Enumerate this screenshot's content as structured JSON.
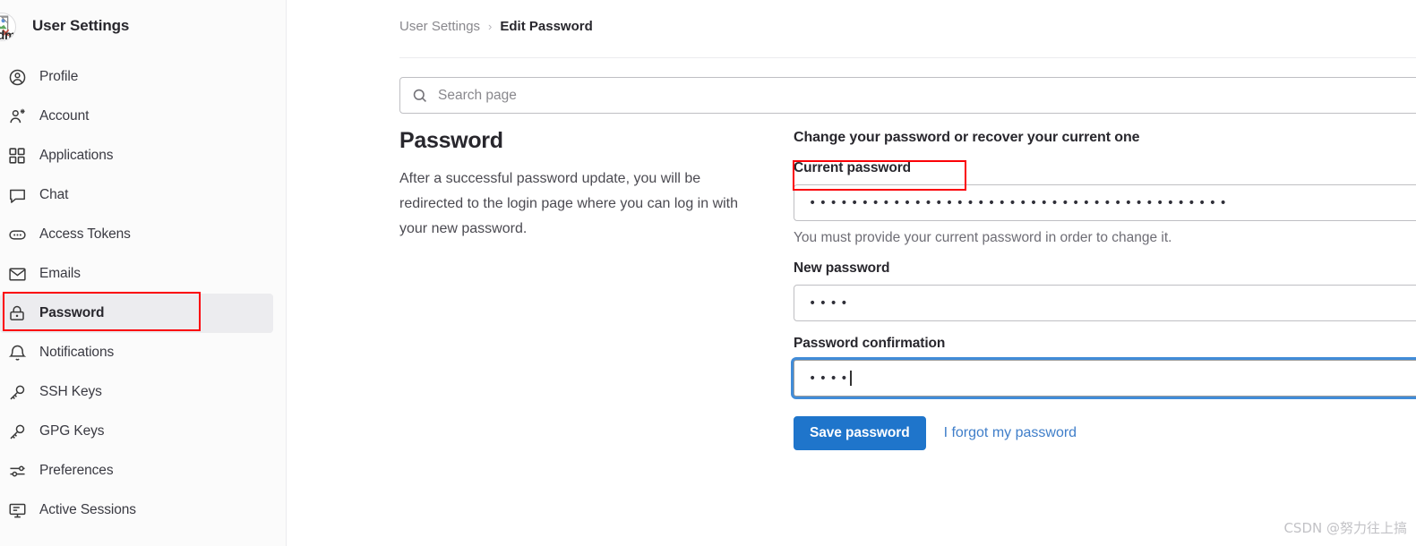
{
  "sidebar": {
    "avatar_alt": "Adm",
    "avatar_icon": "broken-image-icon",
    "title": "User Settings",
    "items": [
      {
        "label": "Profile",
        "icon": "user-circle-icon",
        "active": false
      },
      {
        "label": "Account",
        "icon": "user-gear-icon",
        "active": false
      },
      {
        "label": "Applications",
        "icon": "grid-squares-icon",
        "active": false
      },
      {
        "label": "Chat",
        "icon": "speech-bubble-icon",
        "active": false
      },
      {
        "label": "Access Tokens",
        "icon": "token-oval-icon",
        "active": false
      },
      {
        "label": "Emails",
        "icon": "envelope-icon",
        "active": false
      },
      {
        "label": "Password",
        "icon": "lock-icon",
        "active": true
      },
      {
        "label": "Notifications",
        "icon": "bell-icon",
        "active": false
      },
      {
        "label": "SSH Keys",
        "icon": "key-icon",
        "active": false
      },
      {
        "label": "GPG Keys",
        "icon": "key-icon",
        "active": false
      },
      {
        "label": "Preferences",
        "icon": "sliders-icon",
        "active": false
      },
      {
        "label": "Active Sessions",
        "icon": "monitor-icon",
        "active": false
      }
    ]
  },
  "breadcrumb": {
    "parent": "User Settings",
    "separator": "›",
    "current": "Edit Password"
  },
  "search": {
    "icon": "search-icon",
    "placeholder": "Search page",
    "value": ""
  },
  "main": {
    "title": "Password",
    "description": "After a successful password update, you will be redirected to the login page where you can log in with your new password."
  },
  "form": {
    "heading": "Change your password or recover your current one",
    "current_password": {
      "label": "Current password",
      "value": "••••••••••••••••••••••••••••••••••••••••",
      "help": "You must provide your current password in order to change it.",
      "focused": false
    },
    "new_password": {
      "label": "New password",
      "value": "••••",
      "focused": false
    },
    "password_confirmation": {
      "label": "Password confirmation",
      "value": "••••",
      "focused": true
    },
    "save_label": "Save password",
    "forgot_label": "I forgot my password"
  },
  "annotations": {
    "accent_color": "#fb0007",
    "sidebar_password_box": "Password",
    "current_password_box": "Current password"
  },
  "watermark": "CSDN @努力往上搞",
  "colors": {
    "primary_button": "#1f75cb",
    "link": "#3f7ec9",
    "focus_ring": "#418cd8",
    "sidebar_bg": "#fbfbfb",
    "active_item_bg": "#ececef",
    "annotation_red": "#fb0007"
  }
}
